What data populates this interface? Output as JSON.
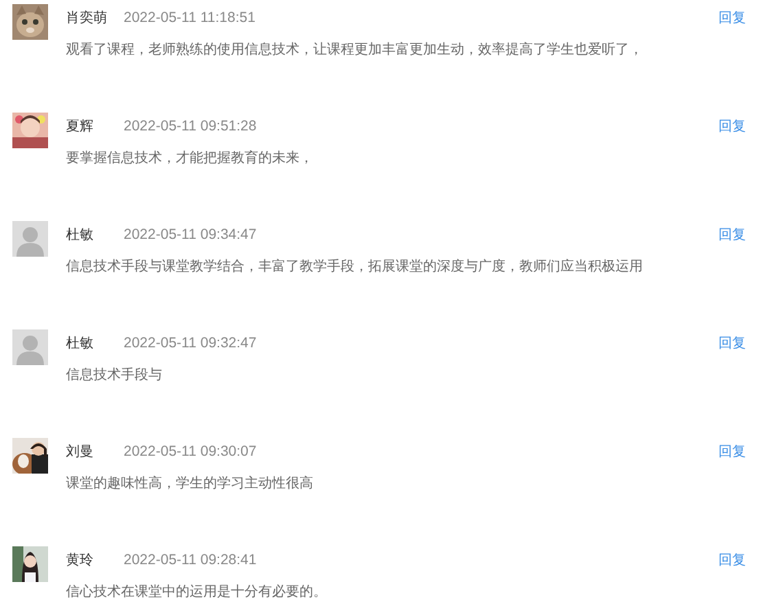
{
  "comments": [
    {
      "name": "肖奕萌",
      "time": "2022-05-11 11:18:51",
      "reply": "回复",
      "text": "观看了课程，老师熟练的使用信息技术，让课程更加丰富更加生动，效率提高了学生也爱听了，"
    },
    {
      "name": "夏辉",
      "time": "2022-05-11 09:51:28",
      "reply": "回复",
      "text": "要掌握信息技术，才能把握教育的未来，"
    },
    {
      "kind": "default",
      "name": "杜敏",
      "time": "2022-05-11 09:34:47",
      "reply": "回复",
      "text": "信息技术手段与课堂教学结合，丰富了教学手段，拓展课堂的深度与广度，教师们应当积极运用"
    },
    {
      "kind": "default",
      "name": "杜敏",
      "time": "2022-05-11 09:32:47",
      "reply": "回复",
      "text": "信息技术手段与"
    },
    {
      "name": "刘曼",
      "time": "2022-05-11 09:30:07",
      "reply": "回复",
      "text": "课堂的趣味性高，学生的学习主动性很高"
    },
    {
      "name": "黄玲",
      "time": "2022-05-11 09:28:41",
      "reply": "回复",
      "text": "信心技术在课堂中的运用是十分有必要的。"
    }
  ]
}
